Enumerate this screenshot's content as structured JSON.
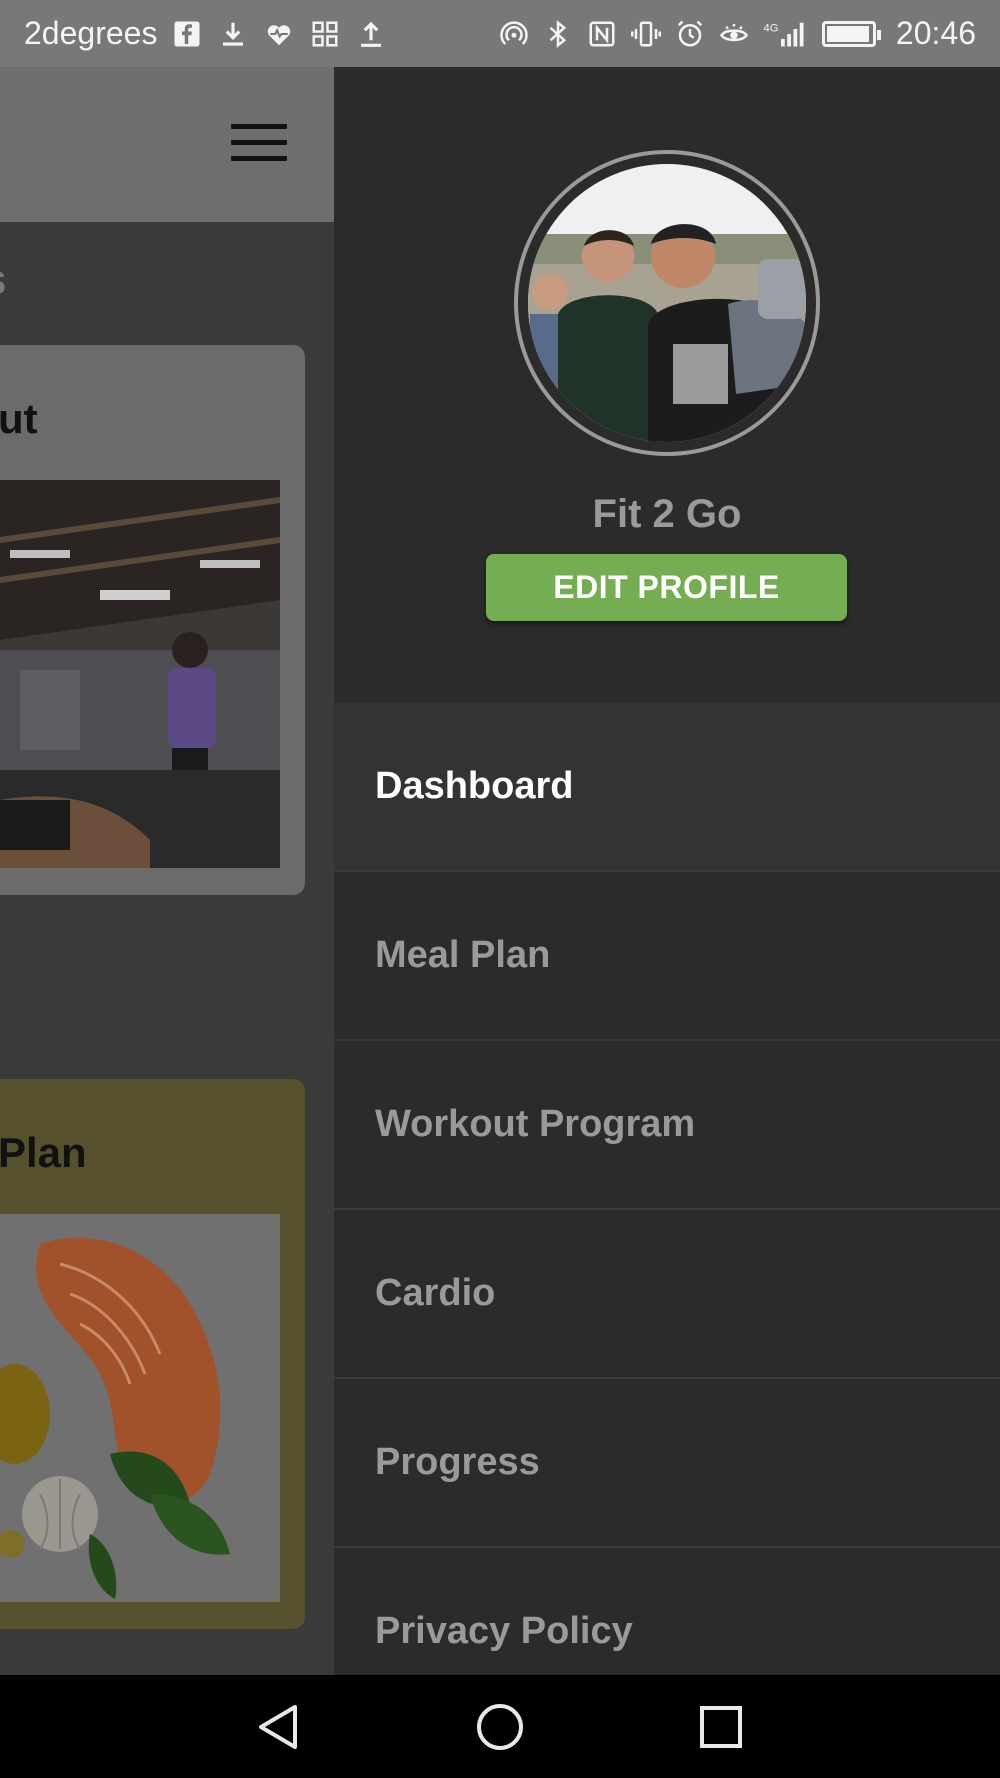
{
  "status_bar": {
    "carrier": "2degrees",
    "time": "20:46",
    "network": "4G",
    "left_icons": [
      "facebook-icon",
      "download-icon",
      "heart-rate-icon",
      "widgets-icon",
      "upload-icon"
    ],
    "right_icons": [
      "hotspot-icon",
      "bluetooth-icon",
      "nfc-icon",
      "vibrate-icon",
      "alarm-icon",
      "eye-comfort-icon",
      "signal-icon",
      "battery-icon"
    ],
    "battery_level": 0.95
  },
  "background_app": {
    "section_letter_fragment": "s",
    "card1_title_fragment": "ut",
    "card2_title_fragment": "Plan"
  },
  "drawer": {
    "username": "Fit 2 Go",
    "edit_profile_label": "EDIT PROFILE",
    "menu": [
      {
        "label": "Dashboard",
        "active": true
      },
      {
        "label": "Meal Plan",
        "active": false
      },
      {
        "label": "Workout Program",
        "active": false
      },
      {
        "label": "Cardio",
        "active": false
      },
      {
        "label": "Progress",
        "active": false
      },
      {
        "label": "Privacy Policy",
        "active": false
      }
    ]
  },
  "nav_bar": {
    "buttons": [
      "back-icon",
      "home-icon",
      "recents-icon"
    ]
  },
  "colors": {
    "accent_green": "#74ad52",
    "drawer_bg": "#2b2b2b",
    "status_bar": "#787878"
  }
}
